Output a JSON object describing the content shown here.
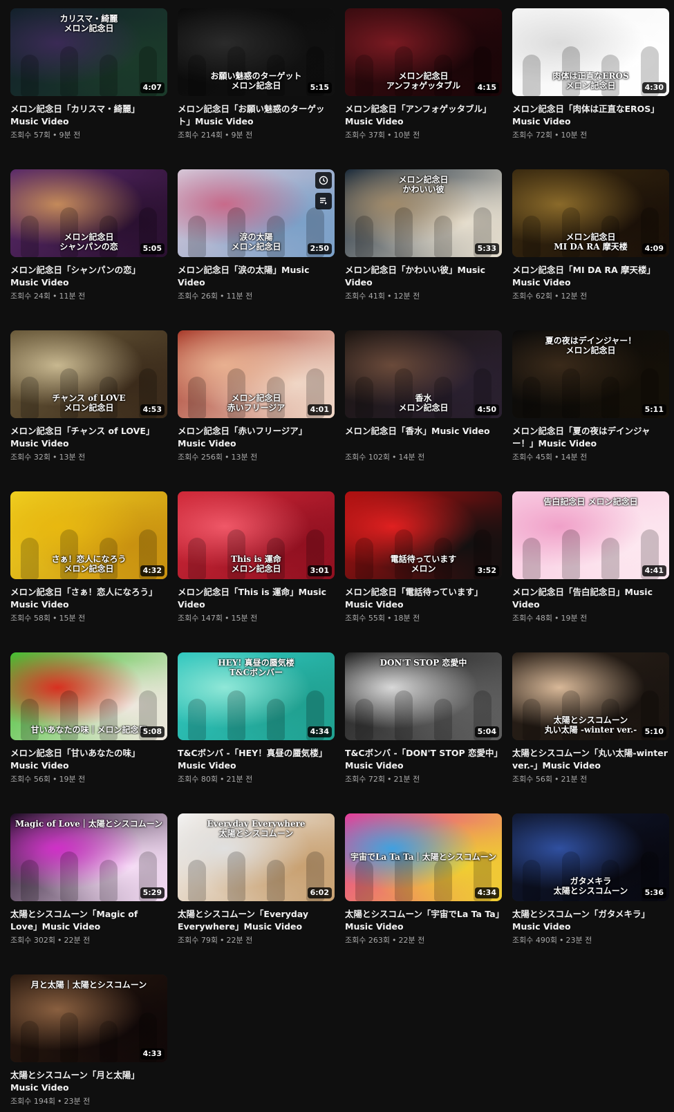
{
  "videos": [
    {
      "title": "メロン記念日「カリスマ・綺麗」Music Video",
      "duration": "4:07",
      "views": "조회수 57회",
      "age": "9분 전",
      "thumb_text": "カリスマ・綺麗\nメロン記念日",
      "colors": [
        "#12202a",
        "#3a2a55",
        "#1b3b2a"
      ],
      "text_pos": "top"
    },
    {
      "title": "メロン記念日「お願い魅惑のターゲット」Music Video",
      "duration": "5:15",
      "views": "조회수 214회",
      "age": "9분 전",
      "thumb_text": "お願い魅惑のターゲット\nメロン記念日",
      "colors": [
        "#0a0a0a",
        "#2b2b2b",
        "#111111"
      ],
      "text_pos": "bottom"
    },
    {
      "title": "メロン記念日「アンフォゲッタブル」Music Video",
      "duration": "4:15",
      "views": "조회수 37회",
      "age": "10분 전",
      "thumb_text": "メロン記念日\nアンフォゲッタブル",
      "colors": [
        "#3a0c10",
        "#7a1a22",
        "#1a0508"
      ],
      "text_pos": "bottom"
    },
    {
      "title": "メロン記念日「肉体は正直なEROS」Music Video",
      "duration": "4:30",
      "views": "조회수 72회",
      "age": "10분 전",
      "thumb_text": "肉体は正直なEROS\nメロン記念日",
      "colors": [
        "#f4f4f4",
        "#dcdcdc",
        "#ffffff"
      ],
      "text_pos": "bottom"
    },
    {
      "title": "メロン記念日「シャンパンの恋」Music Video",
      "duration": "5:05",
      "views": "조회수 24회",
      "age": "11분 전",
      "thumb_text": "メロン記念日\nシャンパンの恋",
      "colors": [
        "#5a2a6a",
        "#c48a5a",
        "#2a1030"
      ],
      "text_pos": "bottom"
    },
    {
      "title": "メロン記念日「涙の太陽」Music Video",
      "duration": "2:50",
      "views": "조회수 26회",
      "age": "11분 전",
      "thumb_text": "涙の太陽\nメロン記念日",
      "colors": [
        "#d8c8d8",
        "#c86a8a",
        "#7aa0c8"
      ],
      "text_pos": "bottom"
    },
    {
      "title": "メロン記念日「かわいい彼」Music Video",
      "duration": "5:33",
      "views": "조회수 41회",
      "age": "12분 전",
      "thumb_text": "メロン記念日\nかわいい彼",
      "colors": [
        "#1a2a3a",
        "#a08a6a",
        "#e8e0d0"
      ],
      "text_pos": "top"
    },
    {
      "title": "メロン記念日「MI DA RA 摩天楼」Music Video",
      "duration": "4:09",
      "views": "조회수 62회",
      "age": "12분 전",
      "thumb_text": "メロン記念日\nMI DA RA 摩天楼",
      "colors": [
        "#3a2a10",
        "#8a6a2a",
        "#1a1008"
      ],
      "text_pos": "bottom"
    },
    {
      "title": "メロン記念日「チャンス of LOVE」Music Video",
      "duration": "4:53",
      "views": "조회수 32회",
      "age": "13분 전",
      "thumb_text": "チャンス of LOVE\nメロン記念日",
      "colors": [
        "#6a5a3a",
        "#c8b890",
        "#3a2a1a"
      ],
      "text_pos": "bottom"
    },
    {
      "title": "メロン記念日「赤いフリージア」Music Video",
      "duration": "4:01",
      "views": "조회수 256회",
      "age": "13분 전",
      "thumb_text": "メロン記念日\n赤いフリージア",
      "colors": [
        "#a83a2a",
        "#e8b090",
        "#f0d8c8"
      ],
      "text_pos": "bottom"
    },
    {
      "title": "メロン記念日「香水」Music Video",
      "duration": "4:50",
      "views": "조회수 102회",
      "age": "14분 전",
      "thumb_text": "香水\nメロン記念日",
      "colors": [
        "#1a1410",
        "#6a4a3a",
        "#2a2030"
      ],
      "text_pos": "bottom"
    },
    {
      "title": "メロン記念日「夏の夜はデインジャー！」Music Video",
      "duration": "5:11",
      "views": "조회수 45회",
      "age": "14분 전",
      "thumb_text": "夏の夜はデインジャー！\nメロン記念日",
      "colors": [
        "#0a0a0a",
        "#3a2a1a",
        "#151008"
      ],
      "text_pos": "top"
    },
    {
      "title": "メロン記念日「さぁ！恋人になろう」Music Video",
      "duration": "4:32",
      "views": "조회수 58회",
      "age": "15분 전",
      "thumb_text": "さぁ！恋人になろう\nメロン記念日",
      "colors": [
        "#f0d020",
        "#e8b810",
        "#c89010"
      ],
      "text_pos": "bottom"
    },
    {
      "title": "メロン記念日「This is 運命」Music Video",
      "duration": "3:01",
      "views": "조회수 147회",
      "age": "15분 전",
      "thumb_text": "This is 運命\nメロン記念日",
      "colors": [
        "#d02838",
        "#f05868",
        "#901020"
      ],
      "text_pos": "bottom"
    },
    {
      "title": "メロン記念日「電話待っています」Music Video",
      "duration": "3:52",
      "views": "조회수 55회",
      "age": "18분 전",
      "thumb_text": "電話待っています\nメロン",
      "colors": [
        "#b01010",
        "#e02020",
        "#101010"
      ],
      "text_pos": "bottom"
    },
    {
      "title": "メロン記念日「告白記念日」Music Video",
      "duration": "4:41",
      "views": "조회수 48회",
      "age": "19분 전",
      "thumb_text": "告白記念日 メロン記念日",
      "colors": [
        "#f8c8e0",
        "#f0a0c8",
        "#fde8f0"
      ],
      "text_pos": "top"
    },
    {
      "title": "メロン記念日「甘いあなたの味」Music Video",
      "duration": "5:08",
      "views": "조회수 56회",
      "age": "19분 전",
      "thumb_text": "甘いあなたの味｜メロン記念日",
      "colors": [
        "#40c030",
        "#d83020",
        "#f0e8e0"
      ],
      "text_pos": "bottom"
    },
    {
      "title": "T&Cボンバ -「HEY！真昼の蜃気楼」Music Video",
      "duration": "4:34",
      "views": "조회수 80회",
      "age": "21분 전",
      "thumb_text": "HEY! 真昼の蜃気楼\nT&Cボンバー",
      "colors": [
        "#30c8c0",
        "#90e8d8",
        "#20a090"
      ],
      "text_pos": "top"
    },
    {
      "title": "T&Cボンバ -「DON'T STOP 恋愛中」Music Video",
      "duration": "5:04",
      "views": "조회수 72회",
      "age": "21분 전",
      "thumb_text": "DON'T STOP 恋愛中",
      "colors": [
        "#202020",
        "#d8d8d8",
        "#606060"
      ],
      "text_pos": "top"
    },
    {
      "title": "太陽とシスコムーン「丸い太陽-winter ver.-」Music Video",
      "duration": "5:10",
      "views": "조회수 56회",
      "age": "21분 전",
      "thumb_text": "太陽とシスコムーン\n丸い太陽 -winter ver.-",
      "colors": [
        "#2a2018",
        "#d8b898",
        "#1a1410"
      ],
      "text_pos": "bottom"
    },
    {
      "title": "太陽とシスコムーン「Magic of Love」Music Video",
      "duration": "5:29",
      "views": "조회수 302회",
      "age": "22분 전",
      "thumb_text": "Magic of Love｜太陽とシスコムーン",
      "colors": [
        "#1a0a20",
        "#d030c8",
        "#f8e0f8"
      ],
      "text_pos": "top"
    },
    {
      "title": "太陽とシスコムーン「Everyday Everywhere」Music Video",
      "duration": "6:02",
      "views": "조회수 79회",
      "age": "22분 전",
      "thumb_text": "Everyday Everywhere\n太陽とシスコムーン",
      "colors": [
        "#f4f4f4",
        "#e0e0e0",
        "#c8a070"
      ],
      "text_pos": "top"
    },
    {
      "title": "太陽とシスコムーン「宇宙でLa Ta Ta」Music Video",
      "duration": "4:34",
      "views": "조회수 263회",
      "age": "22분 전",
      "thumb_text": "宇宙でLa Ta Ta｜太陽とシスコムーン",
      "colors": [
        "#e83a9a",
        "#40a0e0",
        "#f0d030"
      ],
      "text_pos": "middle"
    },
    {
      "title": "太陽とシスコムーン「ガタメキラ」Music Video",
      "duration": "5:36",
      "views": "조회수 490회",
      "age": "23분 전",
      "thumb_text": "ガタメキラ\n太陽とシスコムーン",
      "colors": [
        "#101830",
        "#3050a0",
        "#080810"
      ],
      "text_pos": "bottom"
    },
    {
      "title": "太陽とシスコムーン「月と太陽」Music Video",
      "duration": "4:33",
      "views": "조회수 194회",
      "age": "23분 전",
      "thumb_text": "月と太陽｜太陽とシスコムーン",
      "colors": [
        "#2a1a10",
        "#8a6040",
        "#100808"
      ],
      "text_pos": "top"
    }
  ],
  "hover_card_index": 5,
  "icons": {
    "watch_later": "clock-icon",
    "add_to_queue": "queue-icon"
  }
}
